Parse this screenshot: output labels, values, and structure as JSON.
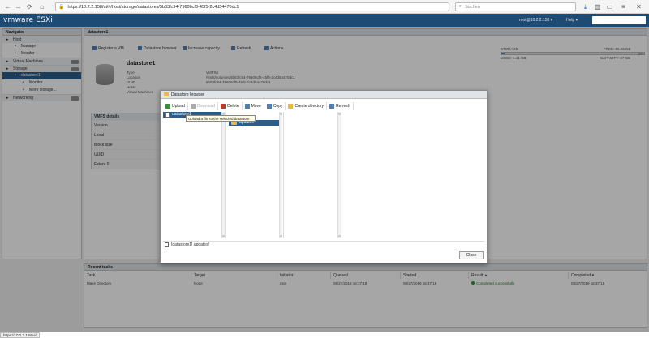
{
  "browser": {
    "url": "https://10.2.2.158/ui/#/host/storage/datastores/5b83fc94-79606cf8-45f5-2c4d54470dc1",
    "search_placeholder": "Suchen"
  },
  "esxi": {
    "logo": "vmware ESXi",
    "user": "root@10.2.2.158 ▾",
    "help": "Help ▾",
    "search_placeholder": "Search"
  },
  "navigator": {
    "title": "Navigator",
    "items": [
      {
        "label": "Host",
        "level": 0,
        "section": true
      },
      {
        "label": "Manage",
        "level": 1
      },
      {
        "label": "Monitor",
        "level": 1
      },
      {
        "label": "Virtual Machines",
        "level": 0,
        "section": true,
        "badge": true
      },
      {
        "label": "Storage",
        "level": 0,
        "section": true,
        "badge": true
      },
      {
        "label": "datastore1",
        "level": 1,
        "selected": true
      },
      {
        "label": "Monitor",
        "level": 2
      },
      {
        "label": "More storage...",
        "level": 2
      },
      {
        "label": "Networking",
        "level": 0,
        "section": true,
        "badge": true
      }
    ]
  },
  "main": {
    "title": "datastore1",
    "toolbar": [
      "Register a VM",
      "Datastore browser",
      "Increase capacity",
      "Refresh",
      "Actions"
    ],
    "ds_name": "datastore1",
    "props": [
      {
        "k": "Type",
        "v": "VMFS6"
      },
      {
        "k": "Location",
        "v": "/vmfs/volumes/5b83fc94-79606cf8-45f5-2c4d54470dc1"
      },
      {
        "k": "UUID",
        "v": "5b83fc94-79606cf8-45f5-2c4d54470dc1"
      },
      {
        "k": "Hosts",
        "v": ""
      },
      {
        "k": "Virtual Machines",
        "v": ""
      }
    ],
    "storage": {
      "label": "STORAGE",
      "free": "FREE: 55.66 GB",
      "pct": "2%",
      "used": "USED: 1.41 GB",
      "capacity": "CAPACITY: 57 GB",
      "fill": 0.02
    },
    "details": {
      "title": "VMFS details",
      "rows": [
        "Version",
        "Local",
        "Block size",
        "UUID",
        "Extent 0"
      ]
    }
  },
  "tasks": {
    "title": "Recent tasks",
    "headers": [
      "Task",
      "Target",
      "Initiator",
      "Queued",
      "Started",
      "Result ▲",
      "Completed ▾"
    ],
    "row": [
      "Make Directory",
      "None",
      "root",
      "08/27/2019 16:37:18",
      "08/27/2019 16:37:18",
      "Completed successfully",
      "08/27/2019 16:37:18"
    ]
  },
  "dialog": {
    "title": "Datastore browser",
    "toolbar": [
      "Upload",
      "Download",
      "Delete",
      "Move",
      "Copy",
      "Create directory",
      "Refresh"
    ],
    "col1": [
      "datastore1"
    ],
    "col2": [
      "updates"
    ],
    "tooltip": "Upload a file to the selected datastore",
    "path": "[datastore1] updates/",
    "close": "Close"
  },
  "status_url": "https://10.2.2.158/ui/"
}
